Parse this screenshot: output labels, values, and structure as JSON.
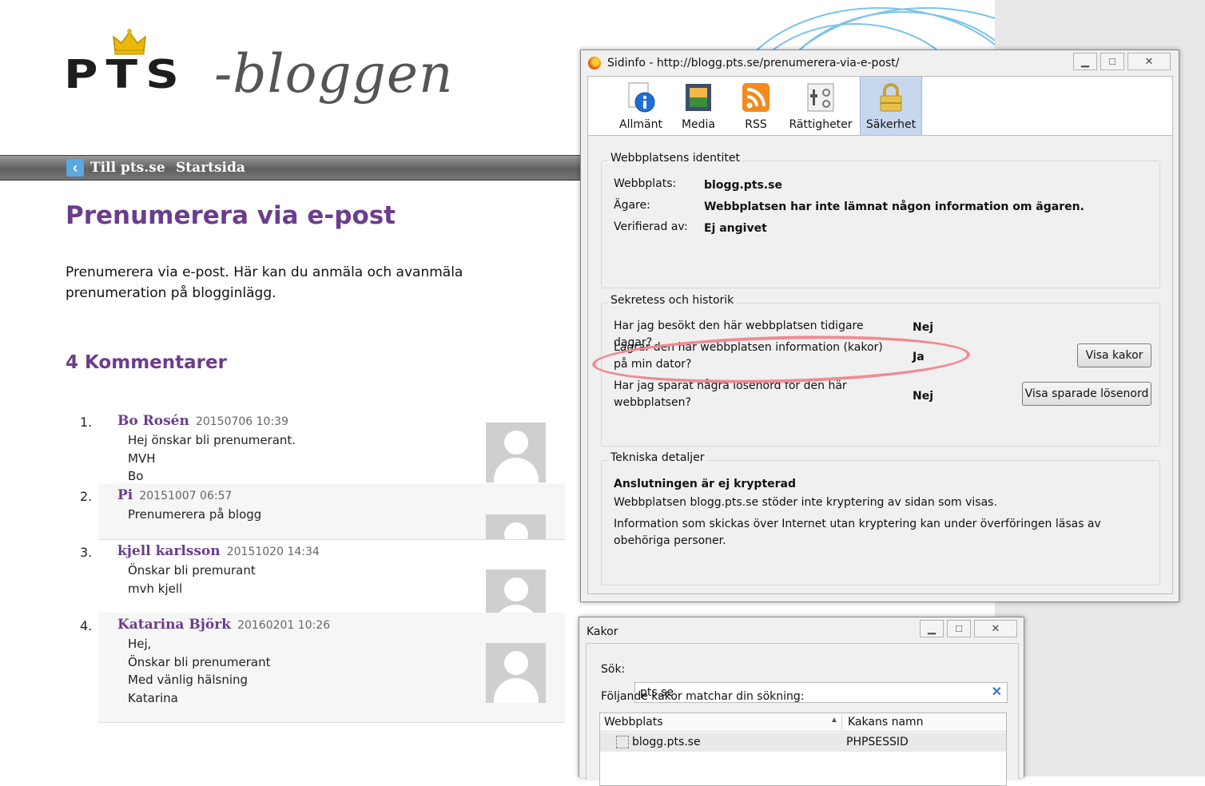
{
  "blog": {
    "logo": "PTS -bloggen",
    "logo_pts": "PTS",
    "logo_dash": "-bloggen",
    "nav": {
      "back_label": "Till pts.se",
      "home_label": "Startsida"
    },
    "title": "Prenumerera via e-post",
    "intro": "Prenumerera via e-post. Här kan du anmäla och avanmäla prenumeration på blogginlägg.",
    "comments_title": "4 Kommentarer",
    "comments": [
      {
        "num": "1.",
        "author": "Bo Rosén",
        "date": "20150706 10:39",
        "lines": [
          "Hej önskar bli prenumerant.",
          "MVH",
          "Bo"
        ]
      },
      {
        "num": "2.",
        "author": "Pi",
        "date": "20151007 06:57",
        "lines": [
          "Prenumerera på blogg"
        ]
      },
      {
        "num": "3.",
        "author": "kjell karlsson",
        "date": "20151020 14:34",
        "lines": [
          "Önskar bli premurant",
          "mvh kjell"
        ]
      },
      {
        "num": "4.",
        "author": "Katarina Björk",
        "date": "20160201 10:26",
        "lines": [
          "Hej,",
          "Önskar bli prenumerant",
          "Med vänlig hälsning",
          "Katarina"
        ]
      }
    ]
  },
  "page_info": {
    "title": "Sidinfo - http://blogg.pts.se/prenumerera-via-e-post/",
    "tabs": [
      {
        "label": "Allmänt",
        "icon": "info-icon"
      },
      {
        "label": "Media",
        "icon": "media-icon"
      },
      {
        "label": "RSS",
        "icon": "rss-icon"
      },
      {
        "label": "Rättigheter",
        "icon": "permissions-icon"
      },
      {
        "label": "Säkerhet",
        "icon": "lock-icon",
        "active": true
      }
    ],
    "identity": {
      "legend": "Webbplatsens identitet",
      "website_label": "Webbplats:",
      "website_value": "blogg.pts.se",
      "owner_label": "Ägare:",
      "owner_value": "Webbplatsen har inte lämnat någon information om ägaren.",
      "verified_label": "Verifierad av:",
      "verified_value": "Ej angivet"
    },
    "privacy": {
      "legend": "Sekretess och historik",
      "q1": "Har jag besökt den här webbplatsen tidigare dagar?",
      "a1": "Nej",
      "q2": "Lagrar den här webbplatsen information (kakor) på min dator?",
      "a2": "Ja",
      "q3": "Har jag sparat några lösenord för den här webbplatsen?",
      "a3": "Nej",
      "cookies_button": "Visa kakor",
      "passwords_button": "Visa sparade lösenord"
    },
    "technical": {
      "legend": "Tekniska detaljer",
      "headline": "Anslutningen är ej krypterad",
      "line1": "Webbplatsen blogg.pts.se stöder inte kryptering av sidan som visas.",
      "line2": "Information som skickas över Internet utan kryptering kan under överföringen läsas av obehöriga personer."
    }
  },
  "cookies": {
    "title": "Kakor",
    "search_label": "Sök:",
    "search_value": "pts.se",
    "match_text": "Följande kakor matchar din sökning:",
    "col_site": "Webbplats",
    "col_name": "Kakans namn",
    "rows": [
      {
        "site": "blogg.pts.se",
        "name": "PHPSESSID"
      }
    ]
  },
  "colors": {
    "accent_purple": "#6b3d8c",
    "highlight_pink": "#f08a93",
    "active_tab": "#c7d7ee"
  }
}
